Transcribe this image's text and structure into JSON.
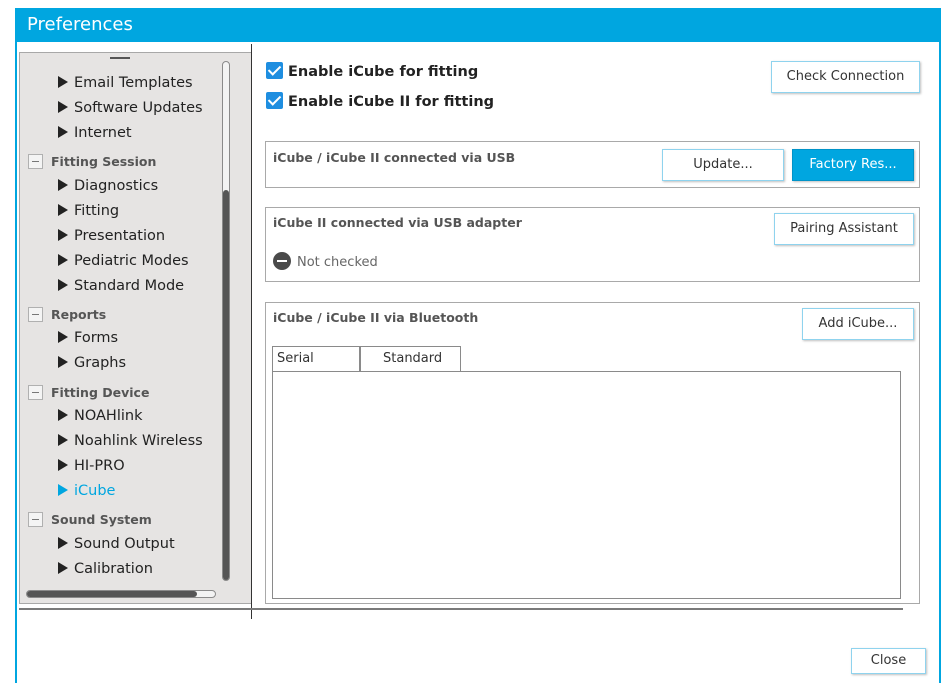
{
  "window": {
    "title": "Preferences"
  },
  "nav": {
    "items": [
      {
        "kind": "item",
        "label": "Email Templates",
        "active": false
      },
      {
        "kind": "item",
        "label": "Software Updates",
        "active": false
      },
      {
        "kind": "item",
        "label": "Internet",
        "active": false
      },
      {
        "kind": "group",
        "label": "Fitting Session"
      },
      {
        "kind": "item",
        "label": "Diagnostics",
        "active": false
      },
      {
        "kind": "item",
        "label": "Fitting",
        "active": false
      },
      {
        "kind": "item",
        "label": "Presentation",
        "active": false
      },
      {
        "kind": "item",
        "label": "Pediatric Modes",
        "active": false
      },
      {
        "kind": "item",
        "label": "Standard Mode",
        "active": false
      },
      {
        "kind": "group",
        "label": "Reports"
      },
      {
        "kind": "item",
        "label": "Forms",
        "active": false
      },
      {
        "kind": "item",
        "label": "Graphs",
        "active": false
      },
      {
        "kind": "group",
        "label": "Fitting Device"
      },
      {
        "kind": "item",
        "label": "NOAHlink",
        "active": false
      },
      {
        "kind": "item",
        "label": "Noahlink Wireless",
        "active": false
      },
      {
        "kind": "item",
        "label": "HI-PRO",
        "active": false
      },
      {
        "kind": "item",
        "label": "iCube",
        "active": true
      },
      {
        "kind": "group",
        "label": "Sound System"
      },
      {
        "kind": "item",
        "label": "Sound Output",
        "active": false
      },
      {
        "kind": "item",
        "label": "Calibration",
        "active": false
      }
    ]
  },
  "settings": {
    "enable_icube": {
      "label": "Enable iCube for fitting",
      "checked": true
    },
    "enable_icube2": {
      "label": "Enable iCube II for fitting",
      "checked": true
    },
    "check_connection_label": "Check Connection"
  },
  "usb": {
    "title": "iCube / iCube II connected via USB",
    "update_label": "Update...",
    "factory_reset_label": "Factory Res..."
  },
  "usb_adapter": {
    "title": "iCube II connected via USB adapter",
    "pairing_label": "Pairing Assistant",
    "status": "Not checked"
  },
  "bluetooth": {
    "title": "iCube / iCube II via Bluetooth",
    "add_label": "Add iCube...",
    "columns": [
      "Serial number",
      "Standard"
    ],
    "rows": []
  },
  "footer": {
    "close_label": "Close"
  },
  "colors": {
    "accent": "#00a6e0",
    "checkbox": "#1e8ee0"
  }
}
